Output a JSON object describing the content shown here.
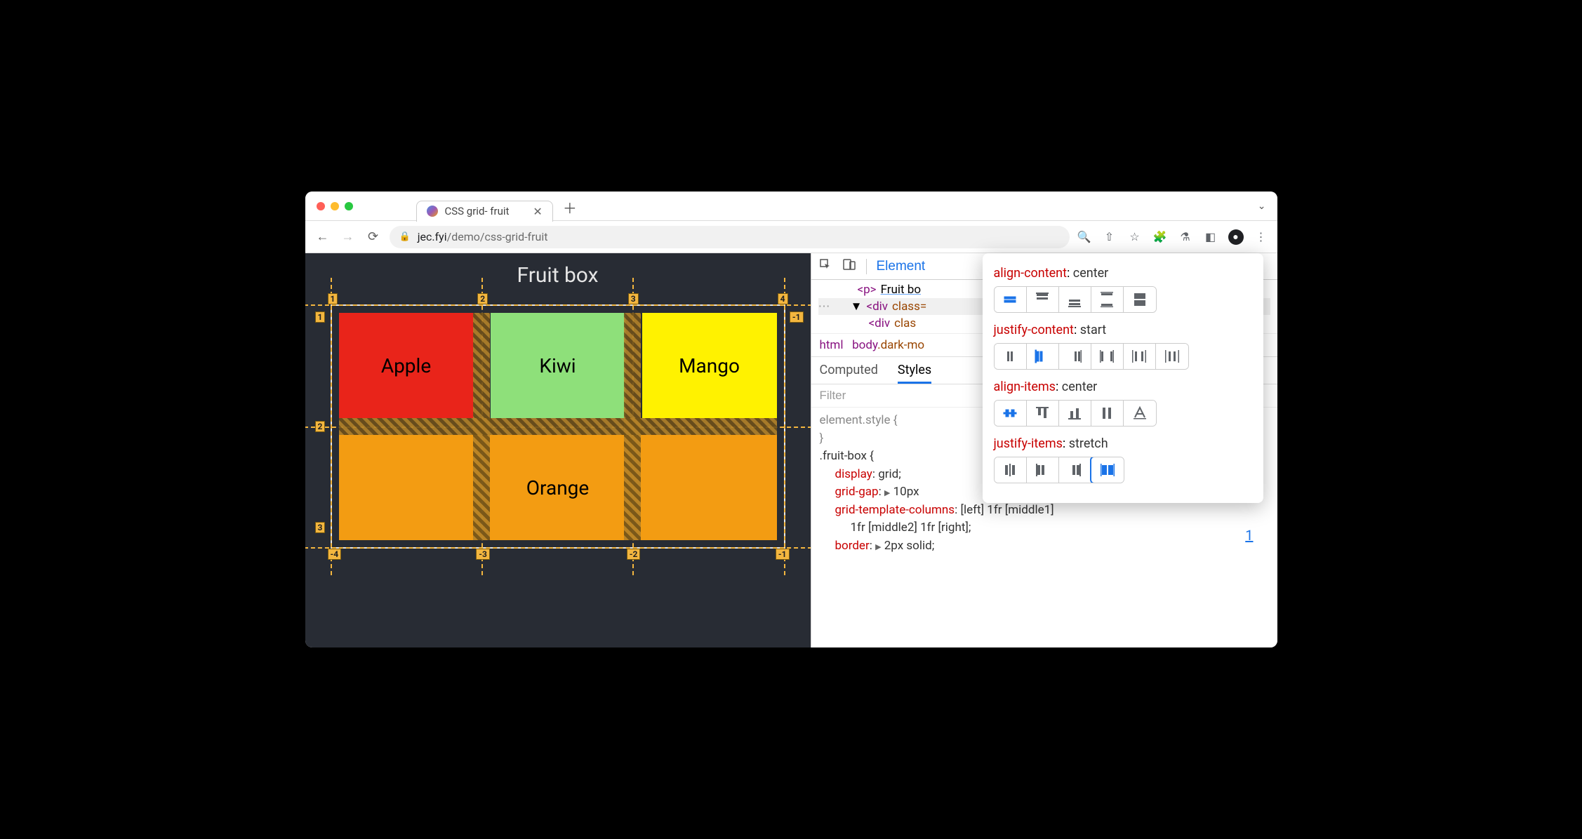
{
  "tab": {
    "title": "CSS grid- fruit"
  },
  "url": {
    "host": "jec.fyi",
    "path": "/demo/css-grid-fruit"
  },
  "page": {
    "heading": "Fruit box",
    "cells": [
      "Apple",
      "Kiwi",
      "Mango",
      "Orange"
    ],
    "line_labels_top": [
      "1",
      "2",
      "3",
      "4"
    ],
    "line_labels_left": [
      "1",
      "2"
    ],
    "line_labels_right": [
      "-1"
    ],
    "line_labels_bottom": [
      "-4",
      "-3",
      "-2",
      "-1"
    ]
  },
  "devtools": {
    "panel": "Element",
    "dom": {
      "p_open": "<p>",
      "p_text": "Fruit bo",
      "div1": "<div class=",
      "div2": "<div clas"
    },
    "crumbs": {
      "html": "html",
      "body": "body",
      "cls": ".dark-mo"
    },
    "subtabs": [
      "Computed",
      "Styles"
    ],
    "filter": "Filter",
    "element_style": "element.style {",
    "close_brace": "}",
    "rule_sel": ".fruit-box {",
    "props": {
      "display": {
        "n": "display",
        "v": "grid;"
      },
      "gap": {
        "n": "grid-gap",
        "v": "10px"
      },
      "gtc1": {
        "n": "grid-template-columns",
        "v": "[left] 1fr [middle1]"
      },
      "gtc2": "1fr [middle2] 1fr [right];",
      "border": {
        "n": "border",
        "v": "2px solid;"
      }
    }
  },
  "popup": {
    "rows": [
      {
        "name": "align-content",
        "value": "center"
      },
      {
        "name": "justify-content",
        "value": "start"
      },
      {
        "name": "align-items",
        "value": "center"
      },
      {
        "name": "justify-items",
        "value": "stretch"
      }
    ],
    "side_num": "1"
  }
}
